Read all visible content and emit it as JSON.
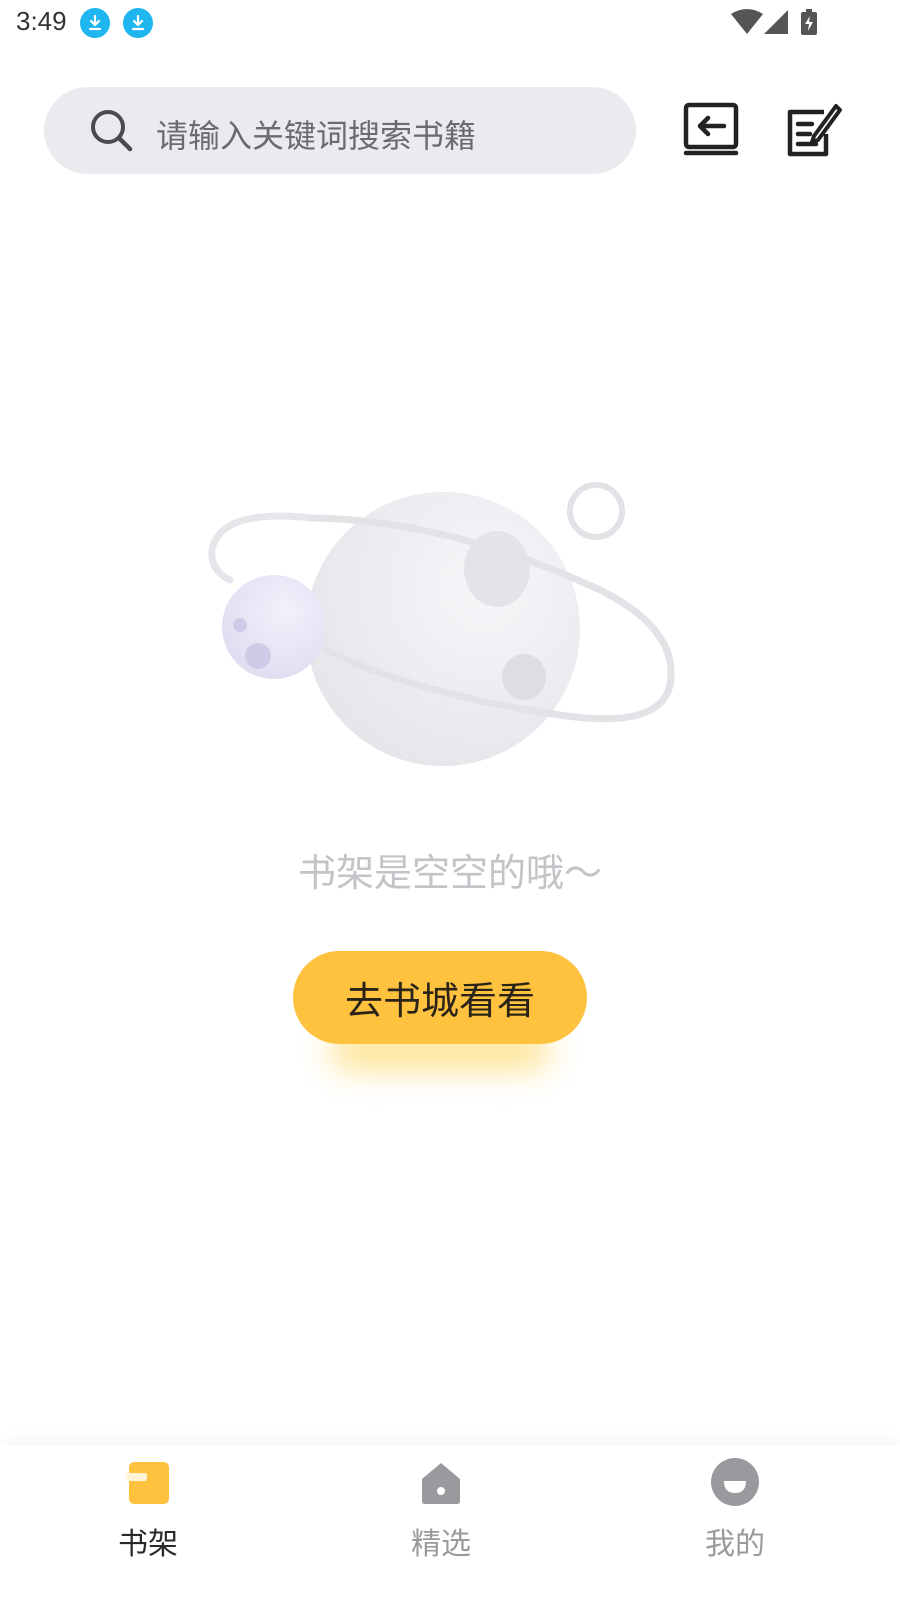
{
  "status_bar": {
    "time": "3:49",
    "notification_icons": [
      "download-icon",
      "download-icon"
    ],
    "system_icons": [
      "wifi-icon",
      "cell-signal-icon",
      "battery-charging-icon"
    ]
  },
  "header": {
    "search": {
      "placeholder": "请输入关键词搜索书籍",
      "icon": "search-icon"
    },
    "actions": [
      {
        "name": "import-book-icon"
      },
      {
        "name": "edit-note-icon"
      }
    ]
  },
  "empty_state": {
    "illustration": "planet-moon-illustration",
    "message": "书架是空空的哦～",
    "button_label": "去书城看看"
  },
  "bottom_nav": {
    "items": [
      {
        "label": "书架",
        "icon": "bookshelf-icon",
        "active": true
      },
      {
        "label": "精选",
        "icon": "home-icon",
        "active": false
      },
      {
        "label": "我的",
        "icon": "profile-icon",
        "active": false
      }
    ]
  },
  "colors": {
    "accent": "#ffc23f",
    "search_bg": "#ebebef",
    "inactive_text": "#9a9a9a",
    "notification_blue": "#1fb6f0"
  }
}
